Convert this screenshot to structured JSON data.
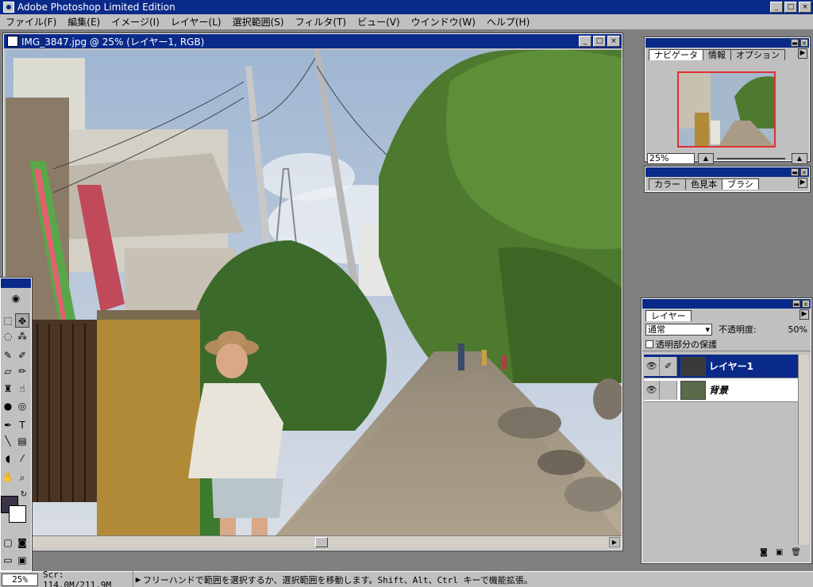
{
  "app": {
    "title": "Adobe Photoshop Limited Edition",
    "window_buttons": [
      "_",
      "□",
      "×"
    ]
  },
  "menu": [
    "ファイル(F)",
    "編集(E)",
    "イメージ(I)",
    "レイヤー(L)",
    "選択範囲(S)",
    "フィルタ(T)",
    "ビュー(V)",
    "ウインドウ(W)",
    "ヘルプ(H)"
  ],
  "document": {
    "title": "IMG_3847.jpg @ 25% (レイヤー1, RGB)"
  },
  "navigator": {
    "tabs": [
      "ナビゲータ",
      "情報",
      "オプション"
    ],
    "zoom": "25%"
  },
  "color_panel": {
    "tabs": [
      "カラー",
      "色見本",
      "ブラシ"
    ]
  },
  "layers": {
    "tabs": [
      "レイヤー"
    ],
    "blend_mode": "通常",
    "opacity_label": "不透明度:",
    "opacity_value": "50%",
    "preserve_label": "透明部分の保護",
    "items": [
      {
        "name": "レイヤー1",
        "selected": true
      },
      {
        "name": "背景",
        "selected": false
      }
    ]
  },
  "status": {
    "zoom": "25%",
    "scratch": "Scr: 114.0M/211.9M",
    "message": "フリーハンドで範囲を選択するか、選択範囲を移動します。Shift、Alt、Ctrl キーで機能拡張。"
  },
  "colors": {
    "title_bar": "#0a2a8a",
    "chrome": "#c0c0c0",
    "workspace": "#808080",
    "foreground": "#3a3446",
    "background": "#ffffff"
  }
}
